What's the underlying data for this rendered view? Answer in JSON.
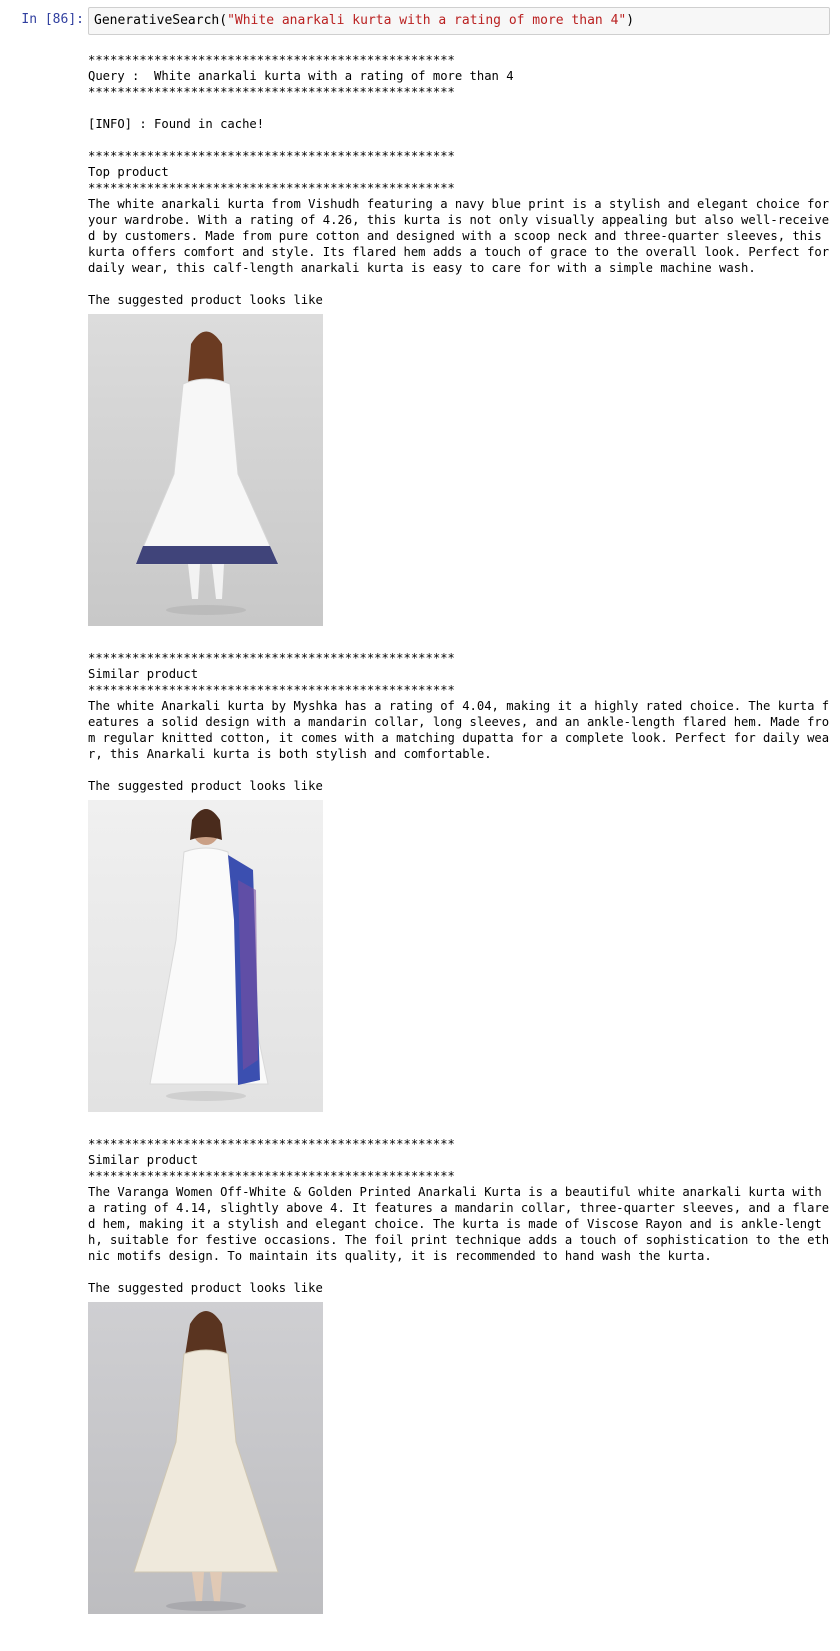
{
  "cell": {
    "prompt": "In [86]:",
    "code_fn": "GenerativeSearch(",
    "code_str": "\"White anarkali kurta with a rating of more than 4\"",
    "code_close": ")"
  },
  "output": {
    "separator": "**************************************************",
    "query_line": "Query :  White anarkali kurta with a rating of more than 4",
    "info_line": "[INFO] : Found in cache!",
    "suggested_line": "The suggested product looks like",
    "products": [
      {
        "heading": "Top product",
        "description": "The white anarkali kurta from Vishudh featuring a navy blue print is a stylish and elegant choice for your wardrobe. With a rating of 4.26, this kurta is not only visually appealing but also well-received by customers. Made from pure cotton and designed with a scoop neck and three-quarter sleeves, this kurta offers comfort and style. Its flared hem adds a touch of grace to the overall look. Perfect for daily wear, this calf-length anarkali kurta is easy to care for with a simple machine wash."
      },
      {
        "heading": "Similar product",
        "description": "The white Anarkali kurta by Myshka has a rating of 4.04, making it a highly rated choice. The kurta features a solid design with a mandarin collar, long sleeves, and an ankle-length flared hem. Made from regular knitted cotton, it comes with a matching dupatta for a complete look. Perfect for daily wear, this Anarkali kurta is both stylish and comfortable."
      },
      {
        "heading": "Similar product",
        "description": "The Varanga Women Off-White & Golden Printed Anarkali Kurta is a beautiful white anarkali kurta with a rating of 4.14, slightly above 4. It features a mandarin collar, three-quarter sleeves, and a flared hem, making it a stylish and elegant choice. The kurta is made of Viscose Rayon and is ankle-length, suitable for festive occasions. The foil print technique adds a touch of sophistication to the ethnic motifs design. To maintain its quality, it is recommended to hand wash the kurta."
      }
    ]
  }
}
